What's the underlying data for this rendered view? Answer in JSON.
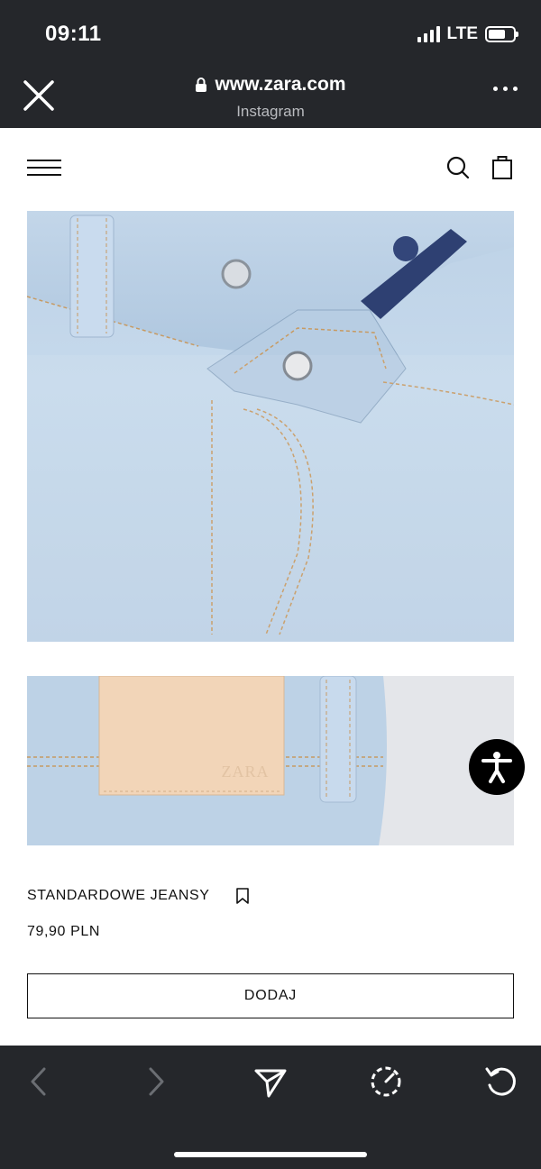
{
  "status_bar": {
    "time": "09:11",
    "network": "LTE"
  },
  "browser": {
    "url": "www.zara.com",
    "source": "Instagram",
    "close_icon": "close-icon",
    "more_icon": "more-dots-icon"
  },
  "site_header": {
    "menu_icon": "hamburger-icon",
    "search_icon": "search-icon",
    "bag_icon": "shopping-bag-icon"
  },
  "product": {
    "name": "STANDARDOWE JEANSY",
    "price": "79,90 PLN",
    "add_label": "DODAJ",
    "bookmark_icon": "bookmark-icon",
    "patch_logo": "ZARA"
  },
  "toolbar": {
    "back_icon": "chevron-left-icon",
    "forward_icon": "chevron-right-icon",
    "share_icon": "send-icon",
    "speed_icon": "speedometer-icon",
    "reload_icon": "reload-icon"
  },
  "colors": {
    "chrome": "#25272b",
    "denim": "#bfd4e7",
    "leather_patch": "#f2d5b8",
    "text": "#111111"
  }
}
